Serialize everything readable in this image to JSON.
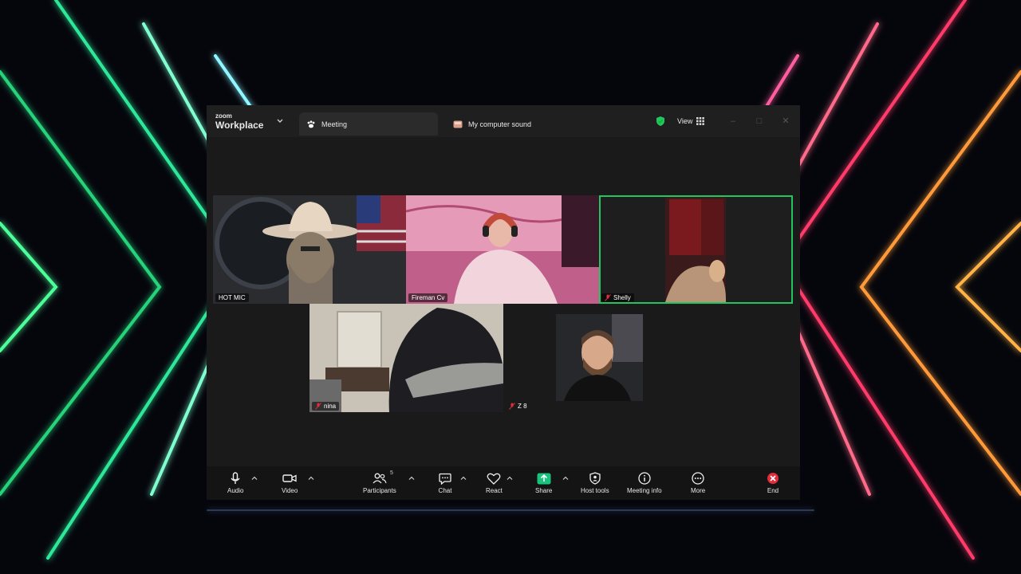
{
  "window": {
    "logo_top": "zoom",
    "logo_bottom": "Workplace",
    "tab_meeting": "Meeting",
    "tab_sound": "My computer sound",
    "view_label": "View"
  },
  "participants": [
    {
      "name": "HOT MIC",
      "muted": false
    },
    {
      "name": "Fireman Cv",
      "muted": false
    },
    {
      "name": "Shelly",
      "muted": true,
      "active_speaker": true
    },
    {
      "name": "nina",
      "muted": true
    },
    {
      "name": "Z 8",
      "muted": true
    },
    {
      "name": "",
      "muted": false
    }
  ],
  "toolbar": {
    "audio": "Audio",
    "video": "Video",
    "participants": "Participants",
    "participants_count": "5",
    "chat": "Chat",
    "react": "React",
    "share": "Share",
    "host_tools": "Host tools",
    "meeting_info": "Meeting info",
    "more": "More",
    "end": "End"
  },
  "colors": {
    "accent_green": "#22c55e",
    "end_red": "#e02d3c",
    "share_green": "#19c37d"
  }
}
